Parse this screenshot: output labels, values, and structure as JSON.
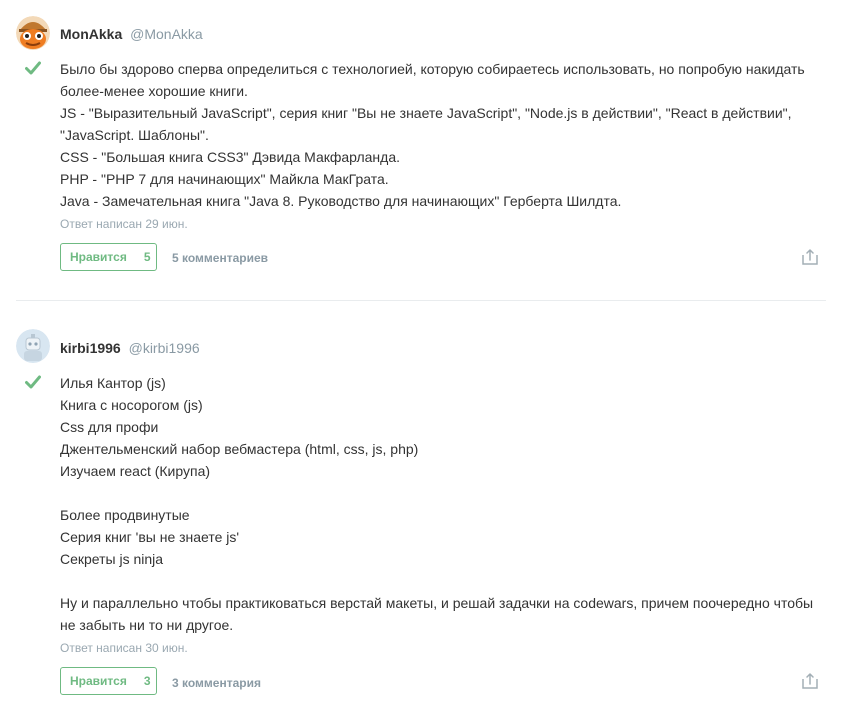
{
  "answers": [
    {
      "author_name": "MonAkka",
      "author_handle": "@MonAkka",
      "avatar_icon": "orange-cartoon-avatar-icon",
      "accepted_icon": "checkmark-icon",
      "content_lines": [
        "Было бы здорово сперва определиться с технологией, которую собираетесь использовать, но попробую накидать",
        "более-менее хорошие книги.",
        "JS - \"Выразительный JavaScript\", серия книг \"Вы не знаете JavaScript\", \"Node.js в действии\", \"React в действии\",",
        "\"JavaScript. Шаблоны\".",
        "CSS - \"Большая книга CSS3\" Дэвида Макфарланда.",
        "PHP - \"PHP 7 для начинающих\" Майкла МакГрата.",
        "Java - Замечательная книга \"Java 8. Руководство для начинающих\" Герберта Шилдта."
      ],
      "meta": "Ответ написан 29 июн.",
      "like_label": "Нравится",
      "like_count": "5",
      "comments_label": "5 комментариев",
      "share_icon": "share-icon"
    },
    {
      "author_name": "kirbi1996",
      "author_handle": "@kirbi1996",
      "avatar_icon": "robot-avatar-icon",
      "accepted_icon": "checkmark-icon",
      "content_lines": [
        "Илья Кантор (js)",
        "Книга с носорогом (js)",
        "Css для профи",
        "Джентельменский набор вебмастера (html, css, js, php)",
        "Изучаем react (Кирупа)",
        "",
        "Более продвинутые",
        "Серия книг 'вы не знаете js'",
        "Секреты js ninja",
        "",
        "Ну и параллельно чтобы практиковаться верстай макеты, и решай задачки на codewars, причем поочередно чтобы",
        "не забыть ни то ни другое."
      ],
      "meta": "Ответ написан 30 июн.",
      "like_label": "Нравится",
      "like_count": "3",
      "comments_label": "3 комментария",
      "share_icon": "share-icon"
    }
  ],
  "colors": {
    "accent_green": "#6fba82",
    "muted_text": "#8a9aa4",
    "divider": "#e9ecee"
  }
}
